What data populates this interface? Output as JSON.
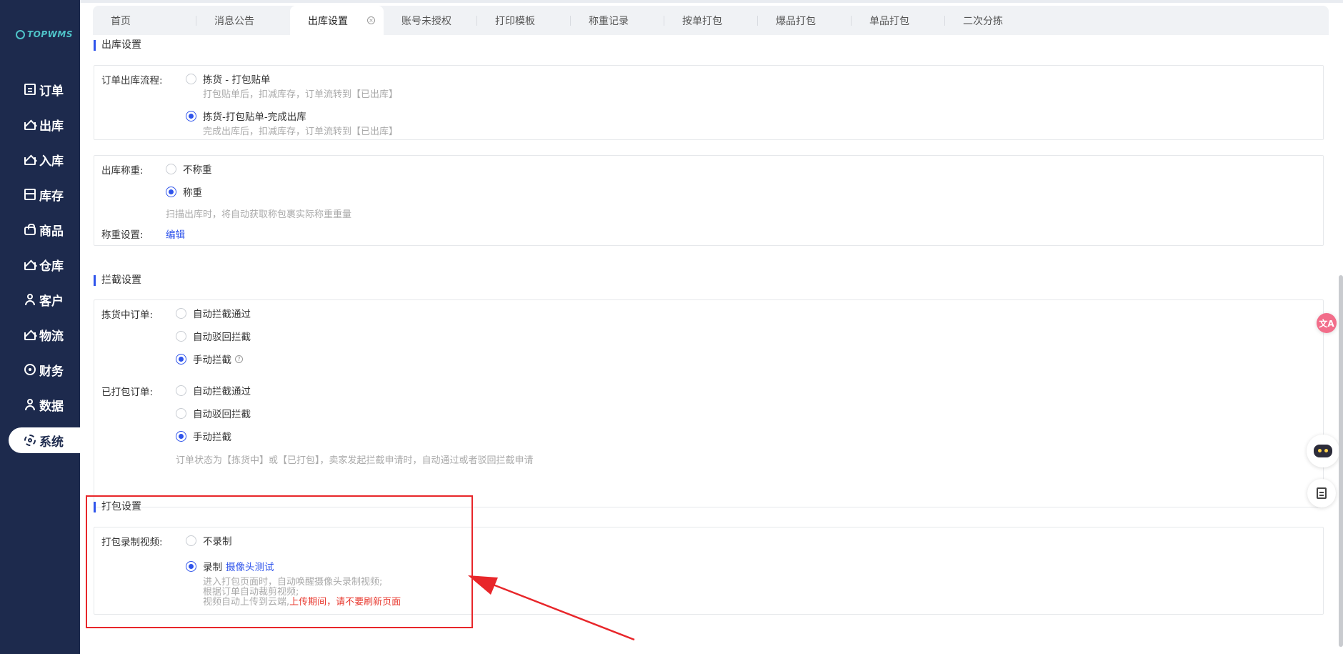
{
  "sidebar": {
    "logo": "TOPWMS",
    "items": [
      {
        "label": "订单",
        "icon": "order-doc-icon"
      },
      {
        "label": "出库",
        "icon": "outbound-icon"
      },
      {
        "label": "入库",
        "icon": "inbound-icon"
      },
      {
        "label": "库存",
        "icon": "inventory-icon"
      },
      {
        "label": "商品",
        "icon": "goods-bag-icon"
      },
      {
        "label": "仓库",
        "icon": "warehouse-icon"
      },
      {
        "label": "客户",
        "icon": "customer-icon"
      },
      {
        "label": "物流",
        "icon": "logistics-icon"
      },
      {
        "label": "财务",
        "icon": "finance-icon"
      },
      {
        "label": "数据",
        "icon": "data-icon"
      },
      {
        "label": "系统",
        "icon": "gear-icon",
        "active": true
      }
    ]
  },
  "tabs": [
    {
      "label": "首页"
    },
    {
      "label": "消息公告"
    },
    {
      "label": "出库设置",
      "active": true
    },
    {
      "label": "账号未授权"
    },
    {
      "label": "打印模板"
    },
    {
      "label": "称重记录"
    },
    {
      "label": "按单打包"
    },
    {
      "label": "爆品打包"
    },
    {
      "label": "单品打包"
    },
    {
      "label": "二次分拣"
    }
  ],
  "outbound": {
    "title": "出库设置",
    "flow_label": "订单出库流程:",
    "flow_opt1": "拣货 - 打包贴单",
    "flow_opt1_hint": "打包贴单后，扣减库存，订单流转到【已出库】",
    "flow_opt2": "拣货-打包贴单-完成出库",
    "flow_opt2_hint": "完成出库后，扣减库存，订单流转到【已出库】",
    "weigh_label": "出库称重:",
    "weigh_opt1": "不称重",
    "weigh_opt2": "称重",
    "weigh_hint": "扫描出库时，将自动获取称包裹实际称重重量",
    "weigh_setting_label": "称重设置:",
    "weigh_setting_link": "编辑"
  },
  "intercept": {
    "title": "拦截设置",
    "picking_label": "拣货中订单:",
    "packed_label": "已打包订单:",
    "opt_auto_pass": "自动拦截通过",
    "opt_auto_reject": "自动驳回拦截",
    "opt_manual": "手动拦截",
    "hint": "订单状态为【拣货中】或【已打包】，卖家发起拦截申请时，自动通过或者驳回拦截申请"
  },
  "pack": {
    "title": "打包设置",
    "video_label": "打包录制视频:",
    "opt_no_record": "不录制",
    "opt_record": "录制",
    "camera_test_link": "摄像头测试",
    "hint_line1": "进入打包页面时，自动唤醒摄像头录制视频;",
    "hint_line2": "根据订单自动裁剪视频;",
    "hint_line3": "视频自动上传到云端,",
    "hint_warning": "上传期间，请不要刷新页面"
  },
  "floating": {
    "translate_glyph": "文A"
  },
  "colors": {
    "sidebar_bg": "#1d2a4d",
    "accent": "#2f54eb",
    "highlight_red": "#e8262a"
  }
}
